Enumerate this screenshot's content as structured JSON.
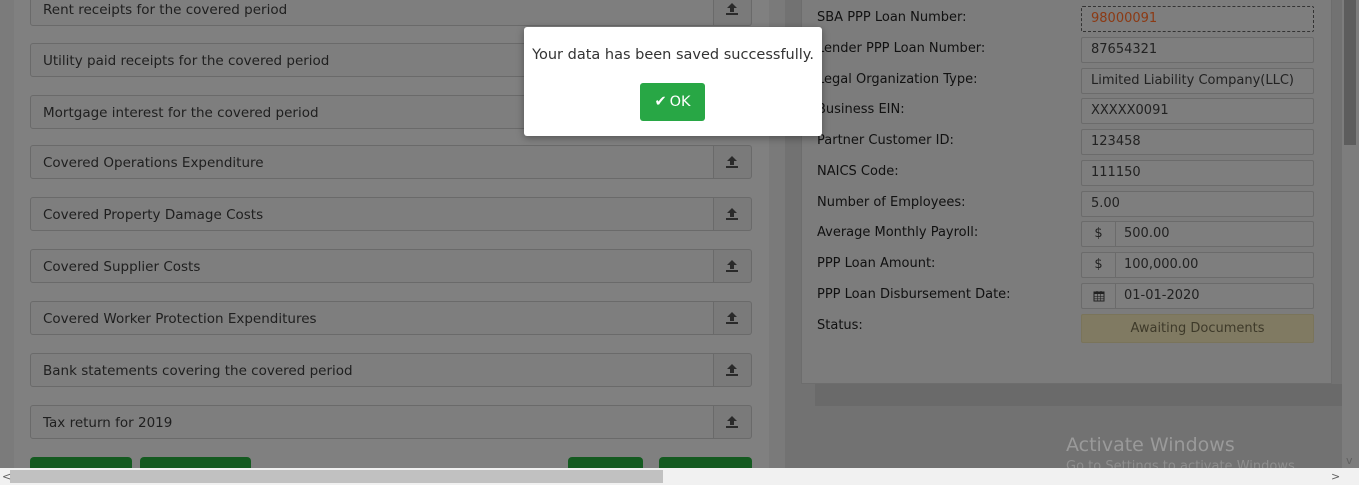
{
  "documents": [
    {
      "label": "Rent receipts for the covered period"
    },
    {
      "label": "Utility paid receipts for the covered period"
    },
    {
      "label": "Mortgage interest for the covered period"
    },
    {
      "label": "Covered Operations Expenditure"
    },
    {
      "label": "Covered Property Damage Costs"
    },
    {
      "label": "Covered Supplier Costs"
    },
    {
      "label": "Covered Worker Protection Expenditures"
    },
    {
      "label": "Bank statements covering the covered period"
    },
    {
      "label": "Tax return for 2019"
    }
  ],
  "loan": {
    "sba_number_label": "SBA PPP Loan Number:",
    "sba_number": "98000091",
    "lender_number_label": "Lender PPP Loan Number:",
    "lender_number": "87654321",
    "org_type_label": "Legal Organization Type:",
    "org_type": "Limited Liability Company(LLC)",
    "ein_label": "Business EIN:",
    "ein": "XXXXX0091",
    "partner_id_label": "Partner Customer ID:",
    "partner_id": "123458",
    "naics_label": "NAICS Code:",
    "naics": "111150",
    "employees_label": "Number of Employees:",
    "employees": "5.00",
    "payroll_label": "Average Monthly Payroll:",
    "payroll": "500.00",
    "amount_label": "PPP Loan Amount:",
    "amount": "100,000.00",
    "disbursement_label": "PPP Loan Disbursement Date:",
    "disbursement_date": "01-01-2020",
    "status_label": "Status:",
    "status": "Awaiting Documents",
    "currency_symbol": "$"
  },
  "modal": {
    "message": "Your data has been saved successfully.",
    "ok_label": "OK"
  },
  "watermark": {
    "title": "Activate Windows",
    "subtitle": "Go to Settings to activate Windows."
  },
  "scrollbar": {
    "left_arrow": "<",
    "right_arrow": ">",
    "down_arrow": "v"
  },
  "colors": {
    "ok_button": "#28a745",
    "status_badge": "#fff3cd",
    "overlay": "rgba(0,0,0,0.5)"
  }
}
